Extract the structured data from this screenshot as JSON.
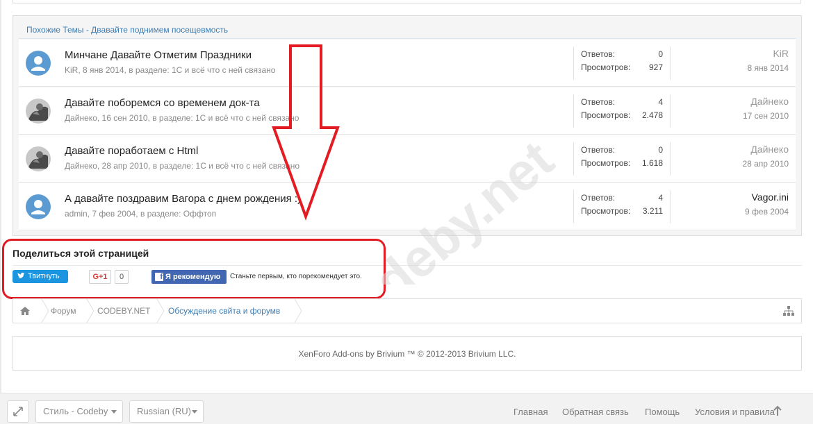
{
  "similar": {
    "header": "Похожие Темы - Двавайте поднимем посещевмость",
    "threads": [
      {
        "avatar": "default-avatar",
        "title": "Минчане Давайте Отметим Праздники",
        "meta": "KiR, 8 янв 2014, в разделе: 1С и всё что с ней связано",
        "replies_label": "Ответов:",
        "replies": "0",
        "views_label": "Просмотров:",
        "views": "927",
        "last_user": "KiR",
        "last_date": "8 янв 2014"
      },
      {
        "avatar": "photo-avatar",
        "title": "Давайте поборемся со временем док-та",
        "meta": "Дайнеко, 16 сен 2010, в разделе: 1С и всё что с ней связано",
        "replies_label": "Ответов:",
        "replies": "4",
        "views_label": "Просмотров:",
        "views": "2.478",
        "last_user": "Дайнеко",
        "last_date": "17 сен 2010"
      },
      {
        "avatar": "photo-avatar",
        "title": "Давайте поработаем с Html",
        "meta": "Дайнеко, 28 апр 2010, в разделе: 1С и всё что с ней связано",
        "replies_label": "Ответов:",
        "replies": "0",
        "views_label": "Просмотров:",
        "views": "1.618",
        "last_user": "Дайнеко",
        "last_date": "28 апр 2010"
      },
      {
        "avatar": "default-avatar",
        "title": "А давайте поздравим Вагора с днем рождения :)",
        "meta": "admin, 7 фев 2004, в разделе: Оффтоп",
        "replies_label": "Ответов:",
        "replies": "4",
        "views_label": "Просмотров:",
        "views": "3.211",
        "last_user": "Vagor.ini",
        "last_date": "9 фев 2004"
      }
    ]
  },
  "share": {
    "title": "Поделиться этой страницей",
    "tweet_label": "Твитнуть",
    "gplus_label": "G+1",
    "gplus_count": "0",
    "fb_label": "Я рекомендую",
    "fb_text": "Станьте первым, кто порекомендует это."
  },
  "breadcrumb": {
    "items": [
      "Форум",
      "CODEBY.NET",
      "Обсуждение свйта и форумв"
    ]
  },
  "footer": {
    "copyright": "XenForo Add-ons by Brivium ™ © 2012-2013 Brivium LLC."
  },
  "bottom": {
    "style_select": "Стиль - Codeby",
    "lang_select": "Russian (RU)",
    "links": [
      "Главная",
      "Обратная связь",
      "Помощь",
      "Условия и правила"
    ]
  },
  "watermark_text": "codeby.net",
  "colors": {
    "accent": "#3f7db1",
    "highlight_frame": "#e31b23",
    "twitter": "#1b95e0",
    "facebook": "#4267b2"
  }
}
